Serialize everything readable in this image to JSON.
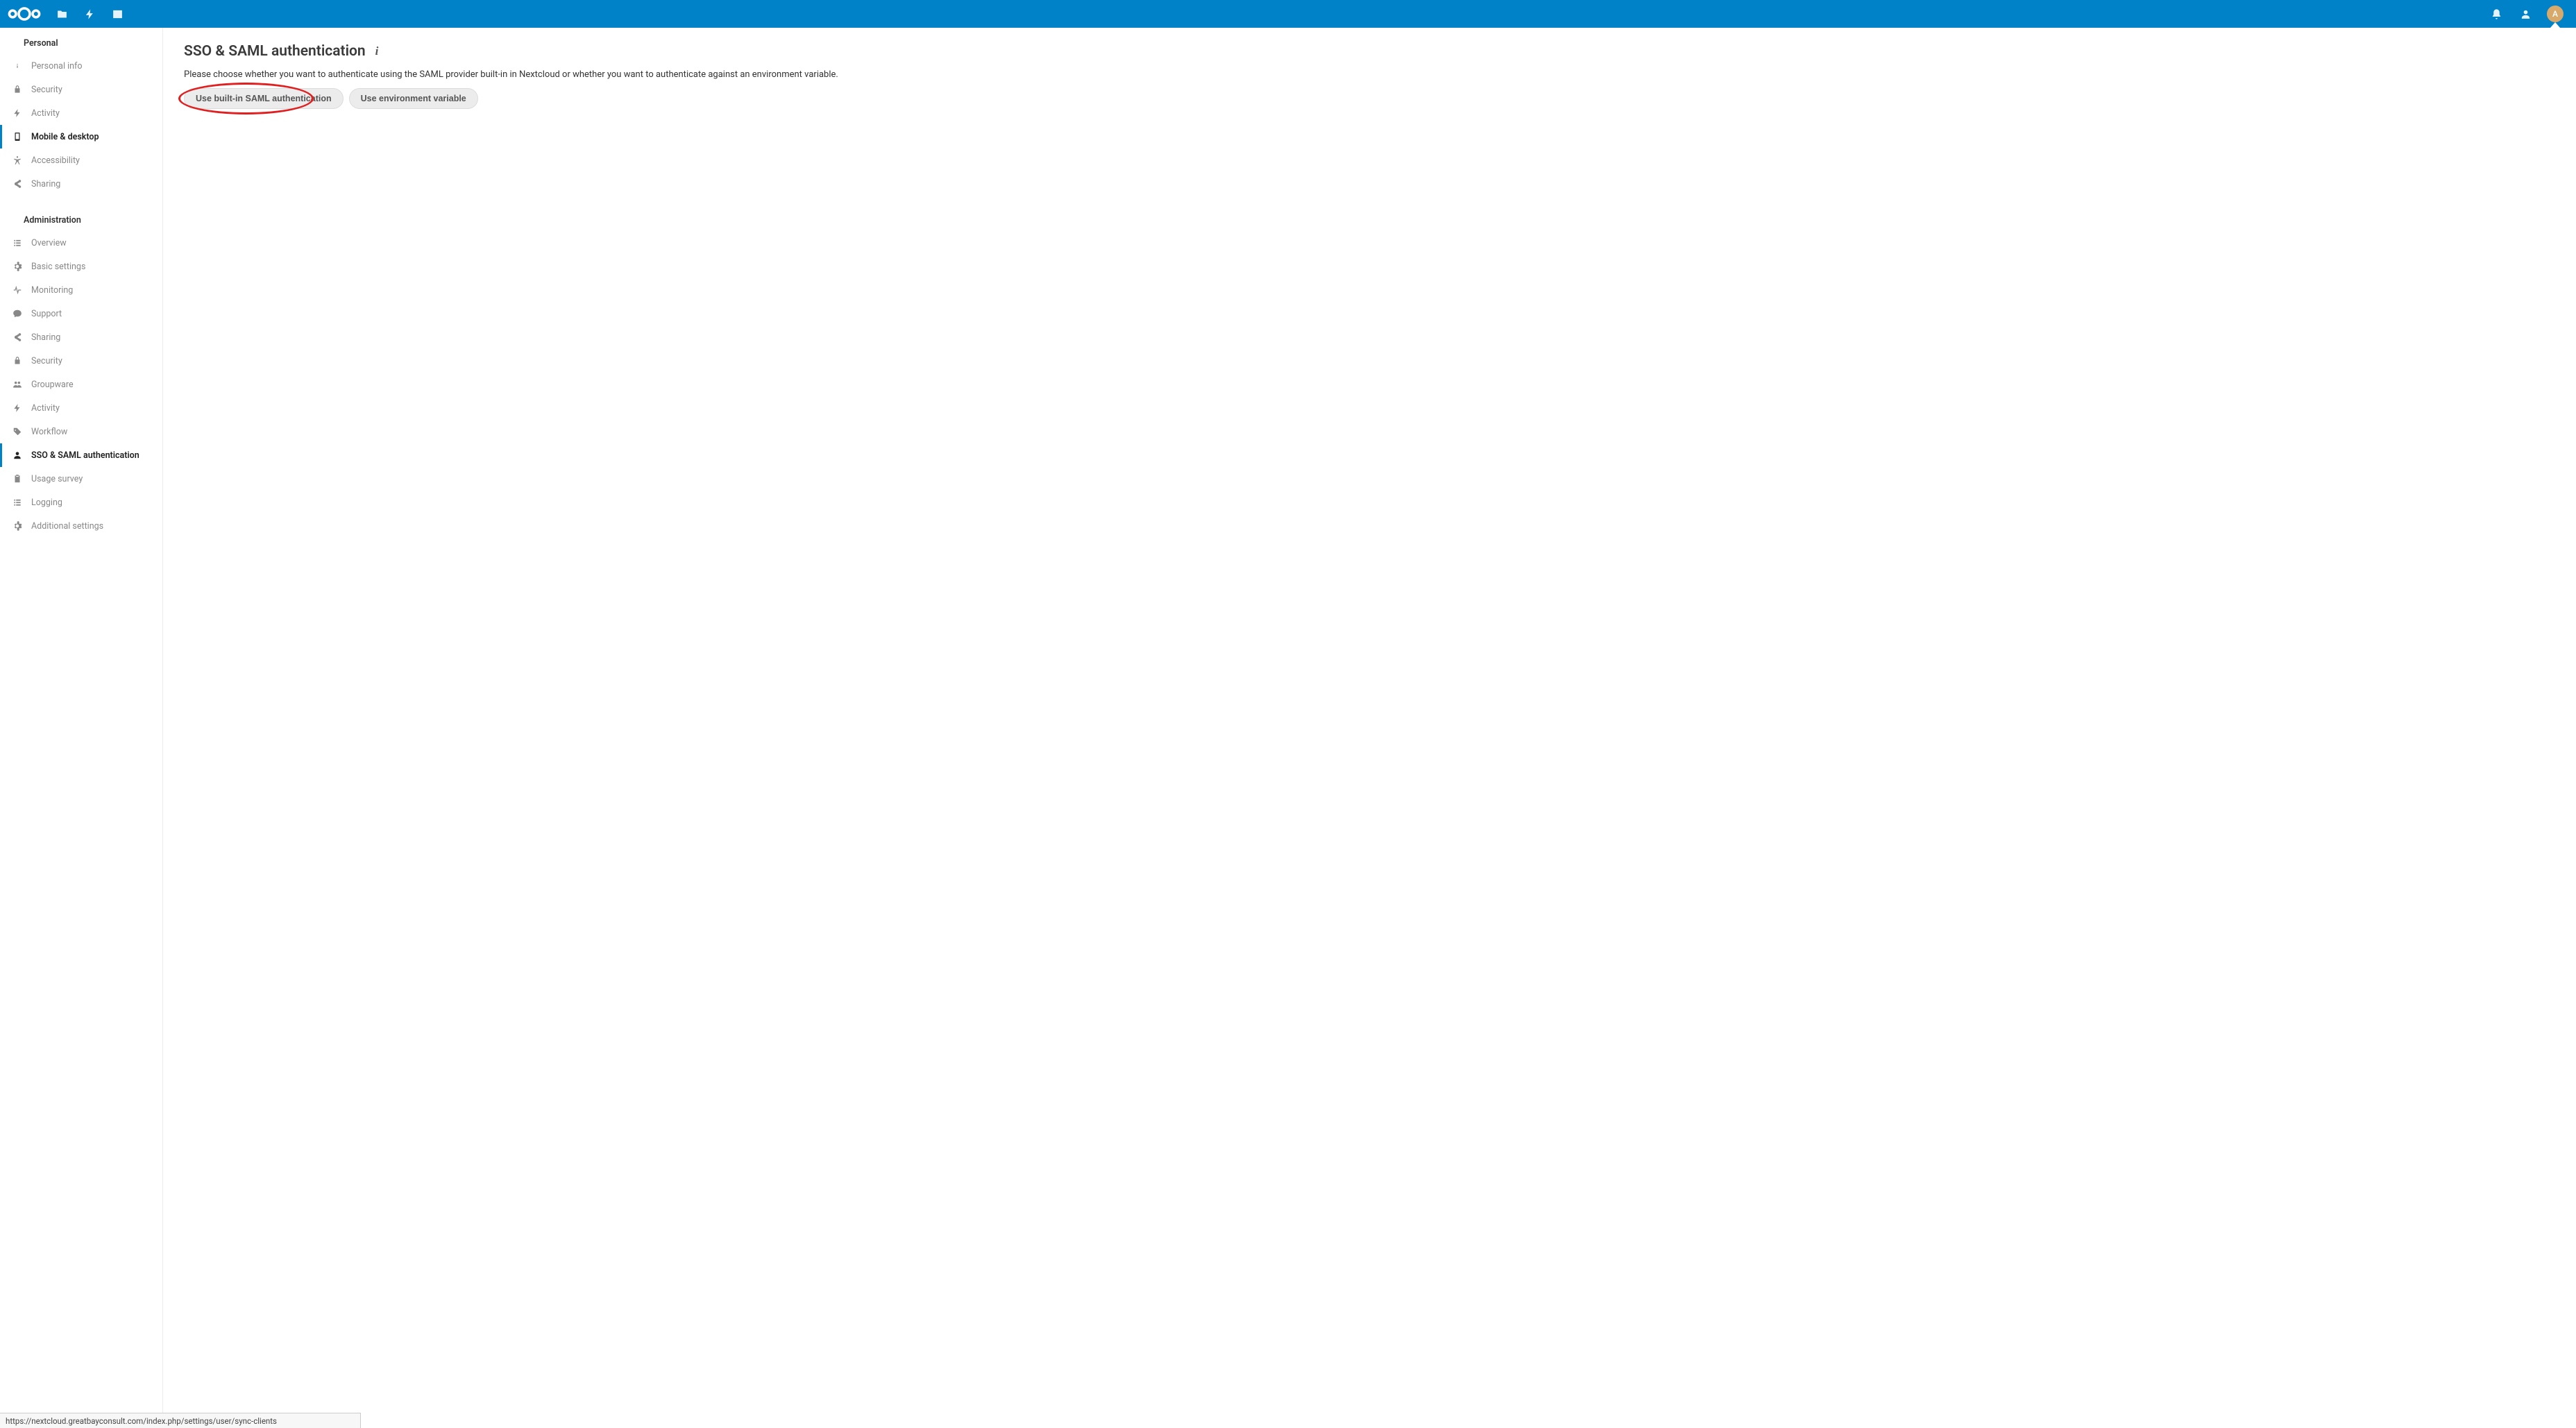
{
  "topbar": {
    "avatar_letter": "A"
  },
  "sidebar": {
    "personal": {
      "title": "Personal",
      "items": [
        {
          "label": "Personal info",
          "icon": "info"
        },
        {
          "label": "Security",
          "icon": "lock"
        },
        {
          "label": "Activity",
          "icon": "bolt"
        },
        {
          "label": "Mobile & desktop",
          "icon": "phone",
          "active": true
        },
        {
          "label": "Accessibility",
          "icon": "accessibility"
        },
        {
          "label": "Sharing",
          "icon": "share"
        }
      ]
    },
    "admin": {
      "title": "Administration",
      "items": [
        {
          "label": "Overview",
          "icon": "list"
        },
        {
          "label": "Basic settings",
          "icon": "gear"
        },
        {
          "label": "Monitoring",
          "icon": "pulse"
        },
        {
          "label": "Support",
          "icon": "chat"
        },
        {
          "label": "Sharing",
          "icon": "share"
        },
        {
          "label": "Security",
          "icon": "lock"
        },
        {
          "label": "Groupware",
          "icon": "users"
        },
        {
          "label": "Activity",
          "icon": "bolt"
        },
        {
          "label": "Workflow",
          "icon": "tag"
        },
        {
          "label": "SSO & SAML authentication",
          "icon": "person",
          "active": true
        },
        {
          "label": "Usage survey",
          "icon": "clipboard"
        },
        {
          "label": "Logging",
          "icon": "list"
        },
        {
          "label": "Additional settings",
          "icon": "gear"
        }
      ]
    }
  },
  "main": {
    "title": "SSO & SAML authentication",
    "description": "Please choose whether you want to authenticate using the SAML provider built-in in Nextcloud or whether you want to authenticate against an environment variable.",
    "button_builtin": "Use built-in SAML authentication",
    "button_envvar": "Use environment variable"
  },
  "statusbar": {
    "url": "https://nextcloud.greatbayconsult.com/index.php/settings/user/sync-clients"
  }
}
